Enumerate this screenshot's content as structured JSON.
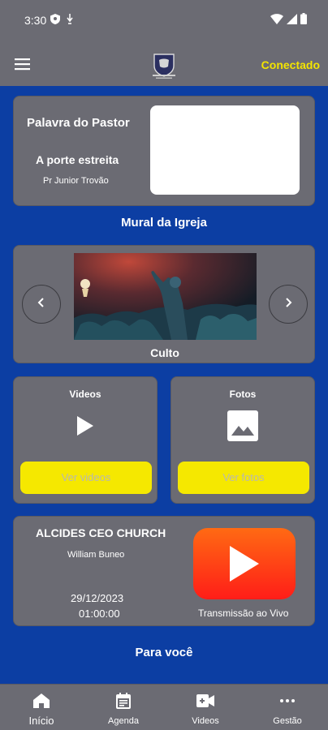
{
  "status_bar": {
    "time": "3:30"
  },
  "header": {
    "status_label": "Conectado"
  },
  "pastor": {
    "title": "Palavra do Pastor",
    "subtitle": "A porte estreita",
    "name": "Pr Junior Trovão"
  },
  "mural": {
    "section_title": "Mural da Igreja",
    "caption": "Culto"
  },
  "videos": {
    "title": "Videos",
    "button_label": "Ver videos"
  },
  "photos": {
    "title": "Fotos",
    "button_label": "Ver fotos"
  },
  "live": {
    "title": "ALCIDES CEO CHURCH",
    "host": "William Buneo",
    "date": "29/12/2023",
    "time": "01:00:00",
    "label": "Transmissão ao Vivo"
  },
  "for_you": {
    "title": "Para você"
  },
  "bottom_nav": {
    "items": [
      {
        "label": "Início",
        "icon": "home-icon"
      },
      {
        "label": "Agenda",
        "icon": "calendar-icon"
      },
      {
        "label": "Videos",
        "icon": "video-camera-icon"
      },
      {
        "label": "Gestão",
        "icon": "more-dots-icon"
      }
    ]
  },
  "colors": {
    "background": "#0c3ea3",
    "card": "#6b6b73",
    "accent_yellow": "#f5e800",
    "youtube_red": "#ff1d18"
  }
}
